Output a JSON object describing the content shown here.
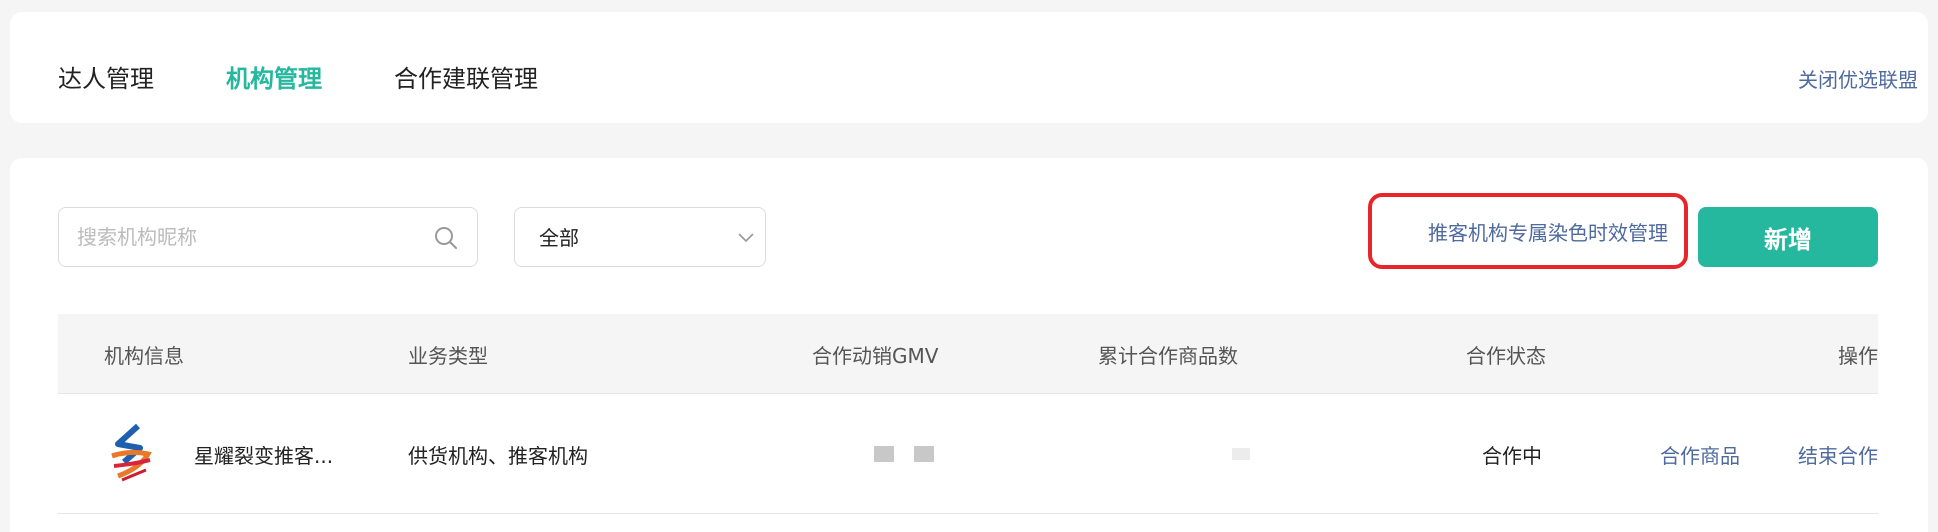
{
  "top_nav": {
    "tabs": [
      {
        "label": "达人管理",
        "active": false
      },
      {
        "label": "机构管理",
        "active": true
      },
      {
        "label": "合作建联管理",
        "active": false
      }
    ],
    "right_link": "关闭优选联盟"
  },
  "toolbar": {
    "search_placeholder": "搜索机构昵称",
    "select_value": "全部",
    "exclusive_link": "推客机构专属染色时效管理",
    "add_button": "新增"
  },
  "table": {
    "headers": [
      "机构信息",
      "业务类型",
      "合作动销GMV",
      "累计合作商品数",
      "合作状态",
      "操作"
    ],
    "rows": [
      {
        "name": "星耀裂变推客...",
        "business_type": "供货机构、推客机构",
        "status": "合作中",
        "actions": [
          "合作商品",
          "结束合作"
        ]
      }
    ]
  },
  "colors": {
    "accent": "#26b79f",
    "link": "#4e6a9e",
    "highlight_border": "#e8262a"
  }
}
